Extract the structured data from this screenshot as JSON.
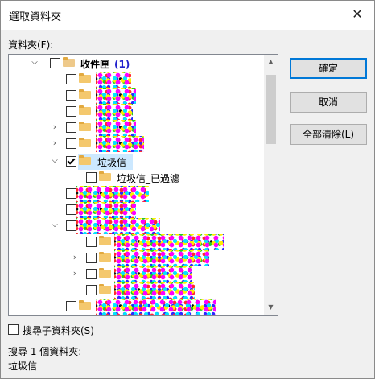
{
  "dialog": {
    "title": "選取資料夾",
    "close_glyph": "✕",
    "folder_label": "資料夾(F):"
  },
  "tree": {
    "root": {
      "label": "收件匣",
      "count": "(1)"
    },
    "junk": {
      "label": "垃圾信"
    },
    "junk_child": {
      "label": "垃圾信_已過濾"
    },
    "chevrons": {
      "expanded": "⌵",
      "collapsed": "›"
    }
  },
  "buttons": {
    "ok": "確定",
    "cancel": "取消",
    "clear_all": "全部清除(L)"
  },
  "search_subfolders": {
    "label": "搜尋子資料夾(S)",
    "checked": false
  },
  "status": {
    "summary": "搜尋 1 個資料夾:",
    "folder": "垃圾信"
  },
  "scrollbar": {
    "up_glyph": "▲",
    "down_glyph": "▼"
  },
  "colors": {
    "accent": "#0078d7",
    "selection": "#cce8ff",
    "count": "#2222cc",
    "folder": "#f4c86d"
  }
}
